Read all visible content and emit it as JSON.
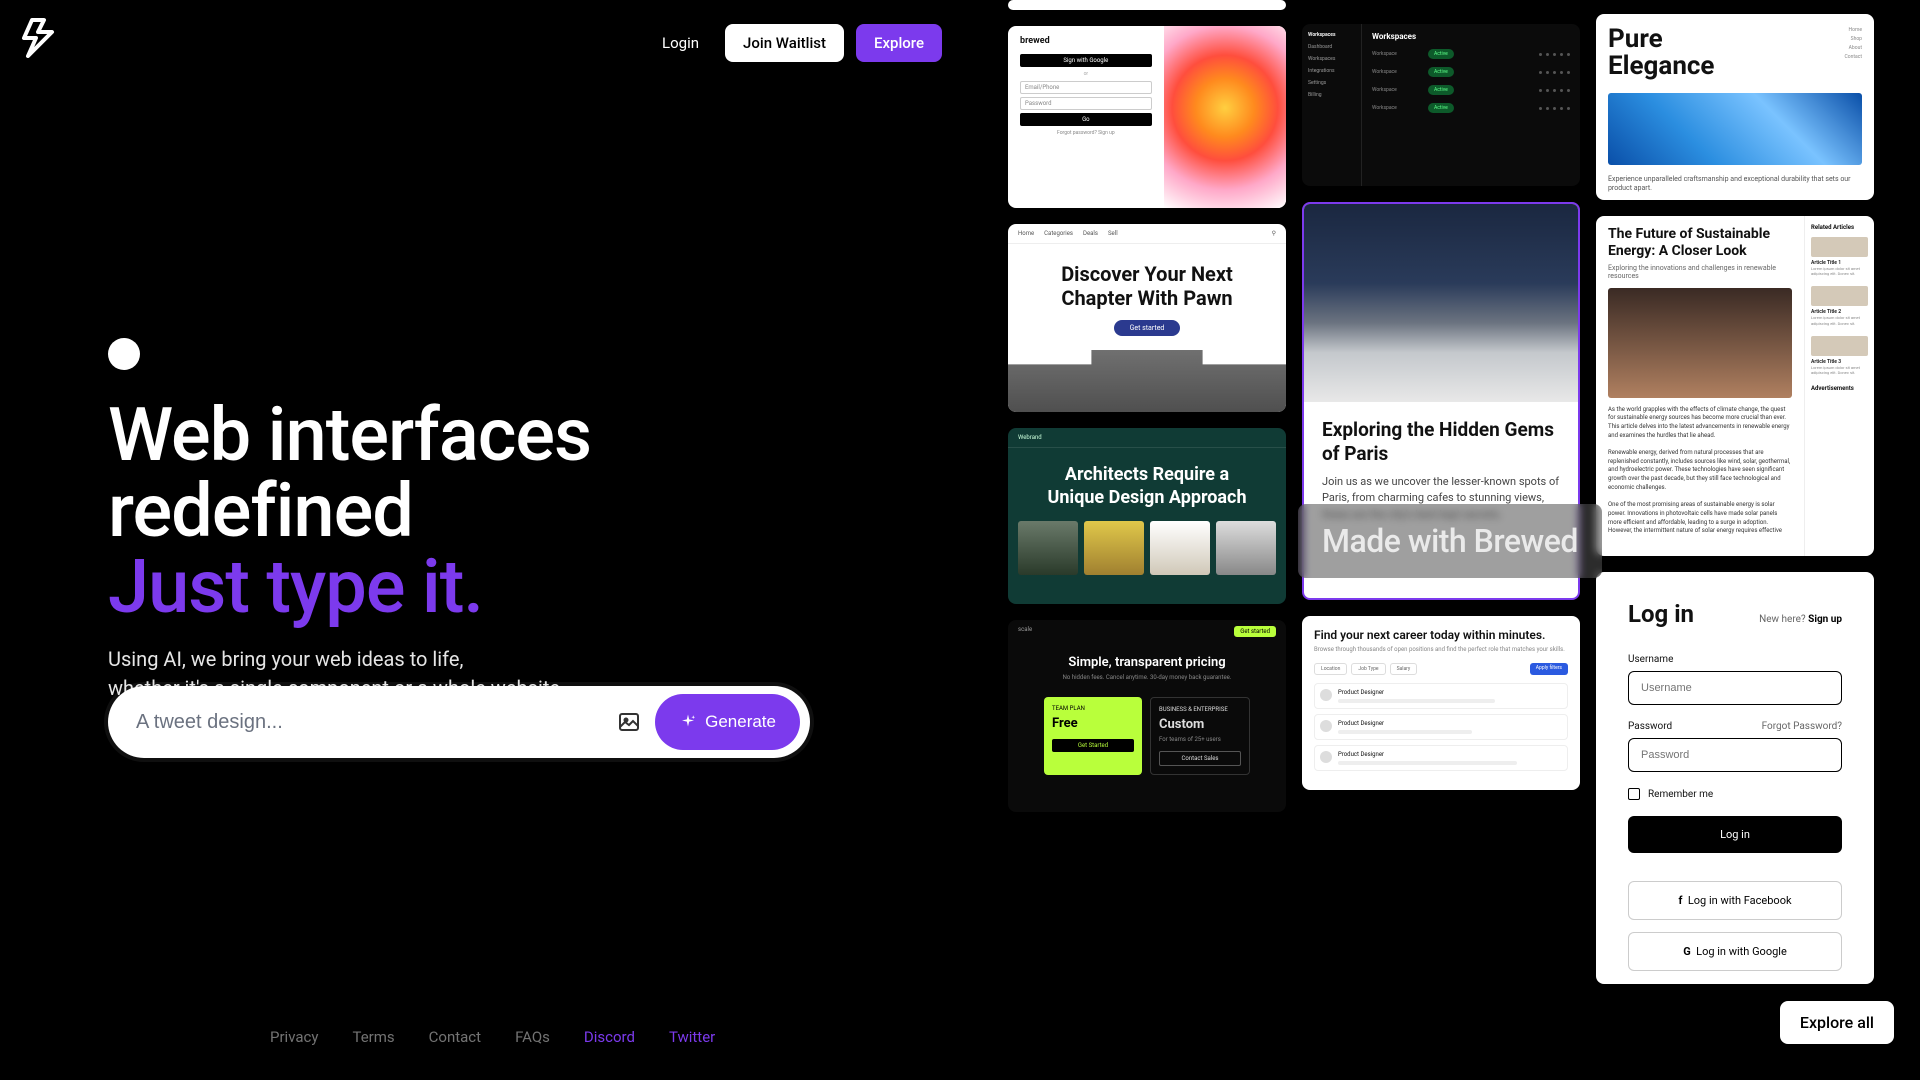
{
  "nav": {
    "login": "Login",
    "waitlist": "Join Waitlist",
    "explore": "Explore"
  },
  "hero": {
    "line1": "Web interfaces redefined",
    "line2": "Just type it.",
    "sub1": "Using AI, we bring your web ideas to life,",
    "sub2": "whether it's a single component or a whole website"
  },
  "prompt": {
    "placeholder": "A tweet design...",
    "generate": "Generate"
  },
  "footer": {
    "privacy": "Privacy",
    "terms": "Terms",
    "contact": "Contact",
    "faqs": "FAQs",
    "discord": "Discord",
    "twitter": "Twitter"
  },
  "overlay": "Made with Brewed",
  "explore_all": "Explore all",
  "cards": {
    "brewed": {
      "title": "brewed",
      "btn1": "Sign with Google",
      "field1": "Email/Phone",
      "field2": "Password",
      "btn2": "Go",
      "foot": "Forgot password? Sign up"
    },
    "pawn": {
      "nav": [
        "Home",
        "Categories",
        "Deals",
        "Sell"
      ],
      "title": "Discover Your Next Chapter With Pawn",
      "cta": "Get started"
    },
    "arch": {
      "brand": "Webrand",
      "title": "Architects Require a Unique Design Approach"
    },
    "price": {
      "brand": "scale",
      "cta": "Get started",
      "title": "Simple, transparent pricing",
      "sub": "No hidden fees. Cancel anytime. 30-day money back guarantee.",
      "plan1_tag": "TEAM PLAN",
      "plan1_name": "Free",
      "plan1_btn": "Get Started",
      "plan2_tag": "BUSINESS & ENTERPRISE",
      "plan2_name": "Custom",
      "plan2_line1": "For teams of 25+ users",
      "plan2_btn": "Contact Sales"
    },
    "work": {
      "side_title": "Workspaces",
      "side_items": [
        "Dashboard",
        "Workspaces",
        "Integrations",
        "Settings",
        "Billing"
      ],
      "title": "Workspaces",
      "row_label": "Workspace",
      "row_pill": "Active"
    },
    "paris": {
      "title": "Exploring the Hidden Gems of Paris",
      "body": "Join us as we uncover the lesser-known spots of Paris, from charming cafes to stunning views, these are the city's best kept secrets."
    },
    "career": {
      "title": "Find your next career today within minutes.",
      "sub": "Browse through thousands of open positions and find the perfect role that matches your skills.",
      "filters": [
        "Location",
        "Job Type",
        "Salary"
      ],
      "apply": "Apply filters",
      "jobs": [
        "Product Designer",
        "Product Designer",
        "Product Designer"
      ]
    },
    "pure": {
      "title1": "Pure",
      "title2": "Elegance",
      "body": "Experience unparalleled craftsmanship and exceptional durability that sets our product apart."
    },
    "sust": {
      "title": "The Future of Sustainable Energy: A Closer Look",
      "sub": "Exploring the innovations and challenges in renewable resources",
      "p1": "As the world grapples with the effects of climate change, the quest for sustainable energy sources has become more crucial than ever. This article delves into the latest advancements in renewable energy and examines the hurdles that lie ahead.",
      "p2": "Renewable energy, derived from natural processes that are replenished constantly, includes sources like wind, solar, geothermal, and hydroelectric power. These technologies have seen significant growth over the past decade, but they still face technological and economic challenges.",
      "p3": "One of the most promising areas of sustainable energy is solar power. Innovations in photovoltaic cells have made solar panels more efficient and affordable, leading to a surge in adoption. However, the intermittent nature of solar energy requires effective",
      "side_title": "Related Articles",
      "articles": [
        {
          "t": "Article Title 1",
          "d": "Lorem ipsum dolor sit amet adipiscing elit. Donec sit."
        },
        {
          "t": "Article Title 2",
          "d": "Lorem ipsum dolor sit amet adipiscing elit. Donec sit."
        },
        {
          "t": "Article Title 3",
          "d": "Lorem ipsum dolor sit amet adipiscing elit. Donec sit."
        }
      ],
      "ads": "Advertisements"
    },
    "login": {
      "title": "Log in",
      "new_pre": "New here? ",
      "new_link": "Sign up",
      "username_label": "Username",
      "username_ph": "Username",
      "password_label": "Password",
      "password_ph": "Password",
      "forgot": "Forgot Password?",
      "remember": "Remember me",
      "btn_login": "Log in",
      "btn_fb": "Log in with Facebook",
      "btn_google": "Log in with Google"
    }
  }
}
